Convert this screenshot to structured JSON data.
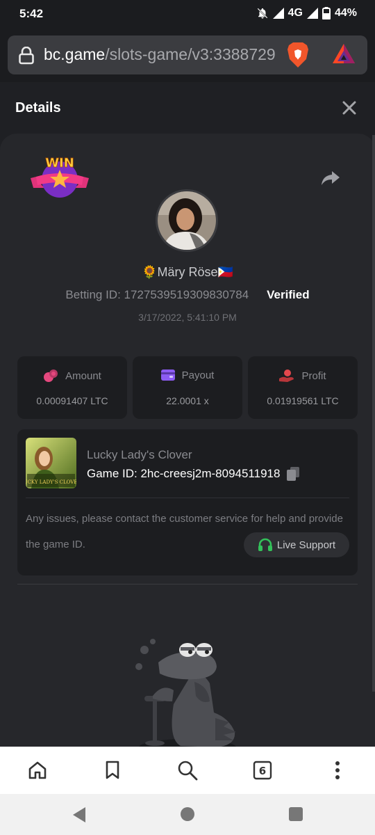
{
  "status_bar": {
    "time": "5:42",
    "network": "4G",
    "battery": "44%"
  },
  "browser": {
    "url_host": "bc.game",
    "url_path": "/slots-game/v3:3388729",
    "icons": [
      "lock-icon",
      "brave-lion-icon",
      "bat-rewards-icon"
    ]
  },
  "panel": {
    "title": "Details"
  },
  "bet": {
    "badge": "WIN",
    "username": "🌻Märy Röse🇵🇭",
    "betting_id_label": "Betting ID: 1727539519309830784",
    "verified": "Verified",
    "date": "3/17/2022, 5:41:10 PM"
  },
  "stats": [
    {
      "label": "Amount",
      "value": "0.00091407 LTC",
      "icon": "coins-icon",
      "color": "#e5487e"
    },
    {
      "label": "Payout",
      "value": "22.0001 x",
      "icon": "wallet-icon",
      "color": "#8c5cf2"
    },
    {
      "label": "Profit",
      "value": "0.01919561 LTC",
      "icon": "hand-coin-icon",
      "color": "#e5484d"
    }
  ],
  "game": {
    "name": "Lucky Lady's Clover",
    "game_id": "Game ID: 2hc-creesj2m-8094511918",
    "thumb_text": "LUCKY LADY'S CLOVER",
    "issue_text": "Any issues, please contact the customer service for help and provide the game ID.",
    "support_label": "Live Support"
  },
  "toolbar": {
    "tab_count": "6"
  }
}
